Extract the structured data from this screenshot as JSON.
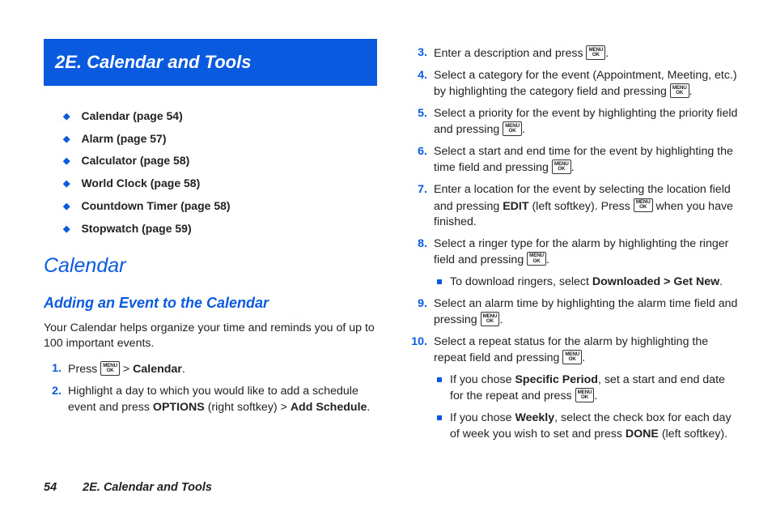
{
  "header": {
    "title": "2E. Calendar and Tools"
  },
  "toc": [
    "Calendar (page 54)",
    "Alarm (page 57)",
    "Calculator (page 58)",
    "World Clock (page 58)",
    "Countdown Timer (page 58)",
    "Stopwatch (page 59)"
  ],
  "section_title": "Calendar",
  "subsection_title": "Adding an Event to the Calendar",
  "intro": "Your Calendar helps organize your time and reminds you of up to 100 important events.",
  "left_steps": {
    "s1": {
      "a": "Press ",
      "b": " > ",
      "c": "Calendar",
      "d": "."
    },
    "s2": {
      "a": "Highlight a day to which you would like to add a schedule event and press ",
      "b": "OPTIONS",
      "c": " (right softkey) > ",
      "d": "Add Schedule",
      "e": "."
    }
  },
  "right_steps": {
    "s3": {
      "a": "Enter a description and press ",
      "b": "."
    },
    "s4": {
      "a": "Select a category for the event (Appointment, Meeting, etc.) by highlighting the category field and pressing ",
      "b": "."
    },
    "s5": {
      "a": "Select a priority for the event by highlighting the priority field and pressing ",
      "b": "."
    },
    "s6": {
      "a": "Select a start and end time for the event by highlighting the time field and pressing ",
      "b": "."
    },
    "s7": {
      "a": "Enter a location for the event by selecting the location field and pressing ",
      "b": "EDIT",
      "c": " (left softkey). Press ",
      "d": " when you have finished."
    },
    "s8": {
      "a": "Select a ringer type for the alarm by highlighting the ringer field and pressing ",
      "b": ".",
      "sub1": {
        "a": "To download ringers, select ",
        "b": "Downloaded > Get New",
        "c": "."
      }
    },
    "s9": {
      "a": "Select an alarm time by highlighting the alarm time field and pressing ",
      "b": "."
    },
    "s10": {
      "a": "Select a repeat status for the alarm by highlighting the repeat field and pressing ",
      "b": ".",
      "sub1": {
        "a": "If you chose ",
        "b": "Specific Period",
        "c": ", set a start and end date for the repeat and press ",
        "d": "."
      },
      "sub2": {
        "a": "If you chose ",
        "b": "Weekly",
        "c": ", select the check box for each day of week you wish to set and press ",
        "d": "DONE",
        "e": " (left softkey)."
      }
    }
  },
  "key": {
    "top": "MENU",
    "bottom": "OK"
  },
  "footer": {
    "page": "54",
    "title": "2E. Calendar and Tools"
  }
}
